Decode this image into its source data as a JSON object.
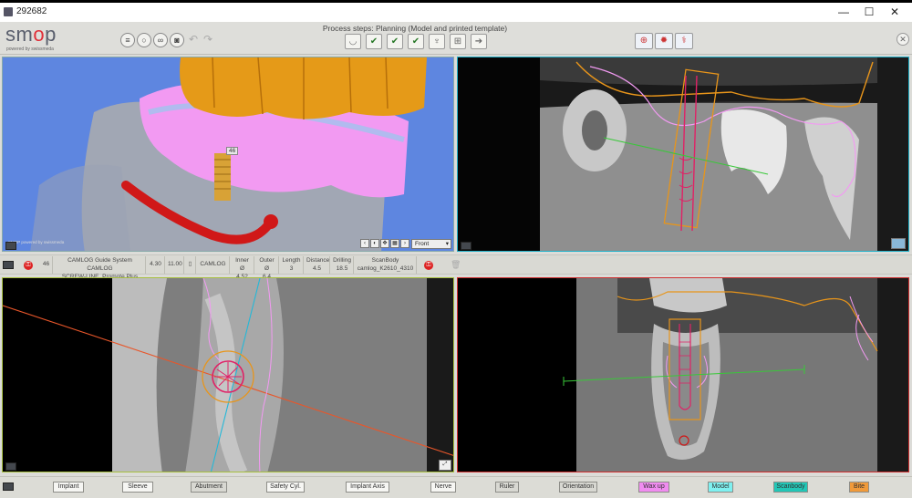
{
  "window": {
    "title": "292682",
    "minimize": "—",
    "maximize": "☐",
    "close": "✕"
  },
  "toolbar": {
    "logo_pre": "sm",
    "logo_o": "o",
    "logo_post": "p",
    "powered_by": "powered by swissmeda",
    "steps_label": "Process steps: Planning (Model and printed template)"
  },
  "viewport3d": {
    "tooth_number": "46",
    "watermark": "SMOP powered by swissmeda",
    "view_select": "Front"
  },
  "infobar": {
    "tooth": "46",
    "system": "CAMLOG Guide System CAMLOG",
    "system_line2": "SCREW-LINE, Promote Plus",
    "diameter": "4.30",
    "length_val": "11.00",
    "kit": "CAMLOG Kit",
    "inner_label": "Inner Ø",
    "inner_value": "4.52",
    "outer_label": "Outer Ø",
    "outer_value": "6.4",
    "length_label": "Length",
    "length_value": "3",
    "distance_label": "Distance",
    "distance_value": "4.5",
    "drilling_label": "Drilling",
    "drilling_value": "18.5",
    "scanbody_label": "ScanBody",
    "scanbody_value": "camlog_K2610_4310"
  },
  "bottombar": {
    "buttons": [
      {
        "label": "Implant",
        "bg": "#f6f6f3"
      },
      {
        "label": "Sleeve",
        "bg": "#f6f6f3"
      },
      {
        "label": "Abutment",
        "bg": "#d8d8d2"
      },
      {
        "label": "Safety Cyl.",
        "bg": "#f6f6f3"
      },
      {
        "label": "Implant Axis",
        "bg": "#f6f6f3"
      },
      {
        "label": "Nerve",
        "bg": "#f6f6f3"
      },
      {
        "label": "Ruler",
        "bg": "#d8d8d2"
      },
      {
        "label": "Orientation",
        "bg": "#d8d8d2"
      },
      {
        "label": "Wax up",
        "bg": "#f08cf0"
      },
      {
        "label": "Model",
        "bg": "#7ef0f0"
      },
      {
        "label": "Scanbody",
        "bg": "#22c6b6"
      },
      {
        "label": "Bite",
        "bg": "#f09a3a"
      }
    ]
  },
  "colors": {
    "viewport_3d_bg": "#5e86e0",
    "crown_orange": "#e59a18",
    "waxup_pink": "#f29af2",
    "nerve_red": "#d01818",
    "axis_cyan": "#23b8d8",
    "orientation_green": "#39c839"
  }
}
